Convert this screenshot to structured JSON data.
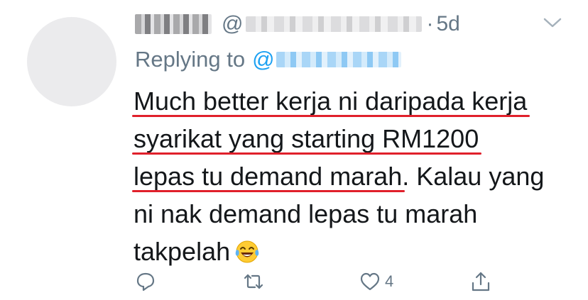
{
  "tweet": {
    "handle_prefix": "@",
    "separator": "·",
    "time": "5d",
    "replying_to_label": "Replying to",
    "mention_prefix": "@",
    "lines": [
      {
        "u": "Much better kerja ni daripada kerja",
        "rest": ""
      },
      {
        "u": "syarikat yang starting RM1200",
        "rest": ""
      },
      {
        "u": "lepas tu demand marah",
        "rest": ". Kalau yang"
      },
      {
        "u": "",
        "rest": "ni nak demand lepas tu marah"
      },
      {
        "u": "",
        "rest": "takpelah"
      }
    ],
    "like_count": "4"
  },
  "icons": {
    "more": "chevron-down-icon",
    "reply": "reply-icon",
    "retweet": "retweet-icon",
    "like": "heart-icon",
    "share": "share-icon",
    "emoji": "tears-of-joy-emoji-icon"
  },
  "colors": {
    "secondary_text": "#657786",
    "link": "#1da1f2",
    "underline": "#e0202b",
    "text": "#14171a"
  }
}
